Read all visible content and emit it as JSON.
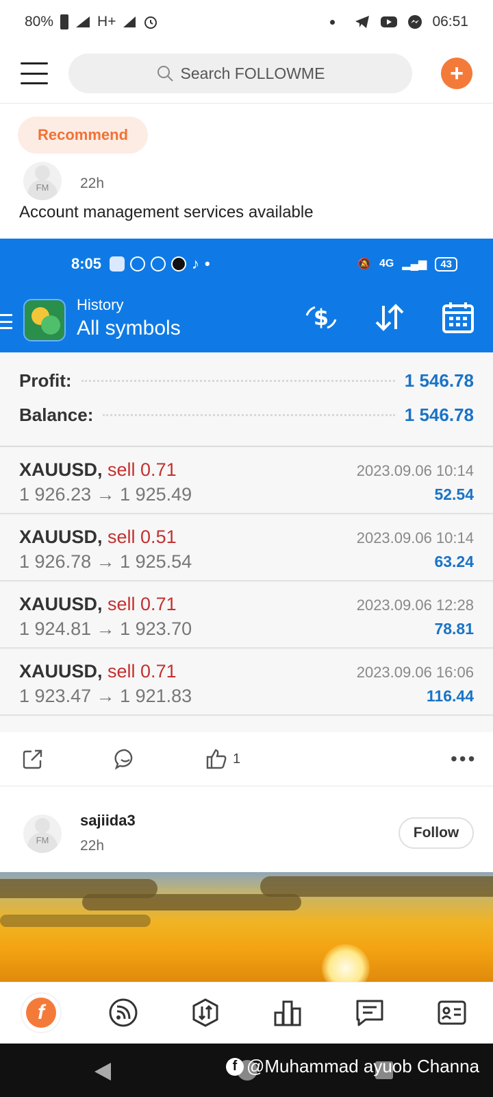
{
  "status_bar": {
    "battery": "80%",
    "network": "H+",
    "time": "06:51"
  },
  "app_bar": {
    "search_placeholder": "Search FOLLOWME"
  },
  "feed": {
    "recommend_label": "Recommend"
  },
  "post1": {
    "avatar_text": "FM",
    "time": "22h",
    "text": "Account management services available",
    "likes": "1"
  },
  "screenshot": {
    "status_time": "8:05",
    "battery": "43",
    "net": "4G",
    "title": "History",
    "subtitle": "All symbols",
    "profit_label": "Profit:",
    "profit_value": "1 546.78",
    "balance_label": "Balance:",
    "balance_value": "1 546.78",
    "trades": [
      {
        "symbol": "XAUUSD,",
        "side": "sell 0.71",
        "prices": "1 926.23 → 1 925.49",
        "datetime": "2023.09.06 10:14",
        "profit": "52.54"
      },
      {
        "symbol": "XAUUSD,",
        "side": "sell 0.51",
        "prices": "1 926.78 → 1 925.54",
        "datetime": "2023.09.06 10:14",
        "profit": "63.24"
      },
      {
        "symbol": "XAUUSD,",
        "side": "sell 0.71",
        "prices": "1 924.81 → 1 923.70",
        "datetime": "2023.09.06 12:28",
        "profit": "78.81"
      },
      {
        "symbol": "XAUUSD,",
        "side": "sell 0.71",
        "prices": "1 923.47 → 1 921.83",
        "datetime": "2023.09.06 16:06",
        "profit": "116.44"
      }
    ]
  },
  "post2": {
    "username": "sajiida3",
    "avatar_text": "FM",
    "time": "22h",
    "follow_label": "Follow"
  },
  "watermark": {
    "text": "@Muhammad ayuob Channa"
  },
  "colors": {
    "accent": "#f47a3a",
    "mt_blue": "#0f7ae5",
    "value_blue": "#1a73c6",
    "sell_red": "#c43030"
  }
}
